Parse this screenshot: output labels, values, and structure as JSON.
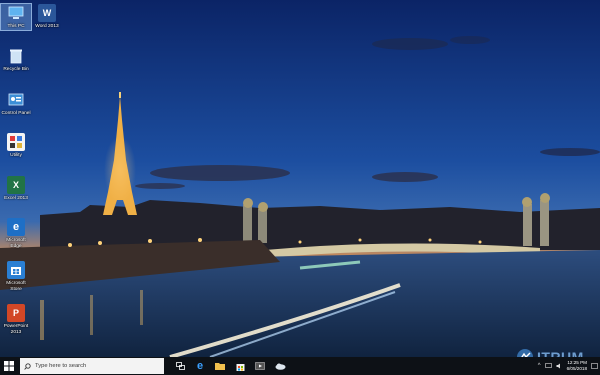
{
  "desktop": {
    "icons": [
      {
        "label": "This PC"
      },
      {
        "label": "Word 2013"
      },
      {
        "label": "Recycle Bin"
      },
      {
        "label": "Control Panel"
      },
      {
        "label": "Utility"
      },
      {
        "label": "Excel 2013"
      },
      {
        "label": "Microsoft Edge"
      },
      {
        "label": "Microsoft Store"
      },
      {
        "label": "PowerPoint 2013"
      }
    ]
  },
  "taskbar": {
    "search_placeholder": "Type here to search",
    "pinned": [
      "task-view-icon",
      "edge-icon",
      "file-explorer-icon",
      "store-icon",
      "media-icon",
      "cloud-app-icon"
    ],
    "clock_time": "12:25 PM",
    "clock_date": "6/05/2018",
    "bg_color": "#0d1116"
  },
  "watermark": {
    "text": "ITRUM"
  },
  "colors": {
    "sky_top": "#0e2a6e",
    "sky_horizon": "#d07a3a",
    "accent": "#0078d7"
  }
}
